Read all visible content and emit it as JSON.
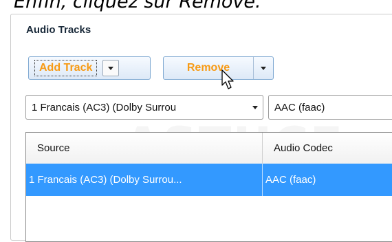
{
  "caption": "Enfin, cliquez sur Remove.",
  "section": {
    "title": "Audio Tracks"
  },
  "buttons": {
    "add_track": "Add Track",
    "remove": "Remove"
  },
  "selectors": {
    "track": "1 Francais (AC3) (Dolby Surrou",
    "codec": "AAC (faac)"
  },
  "table": {
    "headers": [
      "Source",
      "Audio Codec"
    ],
    "rows": [
      {
        "source": "1 Francais (AC3) (Dolby Surrou...",
        "codec": "AAC (faac)",
        "selected": true
      }
    ]
  },
  "colors": {
    "button_text": "#f79a14",
    "selection": "#3399ff"
  },
  "icons": {
    "dropdown": "chevron-down-icon",
    "cursor": "mouse-pointer-icon"
  }
}
